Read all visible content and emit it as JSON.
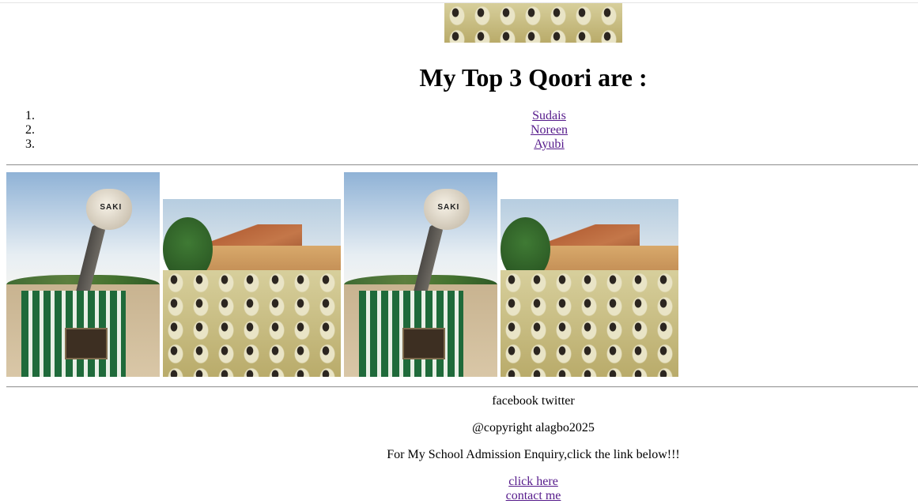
{
  "header": {
    "title": "My Top 3 Qoori are :"
  },
  "qoori_list": [
    {
      "number": "1.",
      "name": "Sudais"
    },
    {
      "number": "2.",
      "name": "Noreen"
    },
    {
      "number": "3.",
      "name": "Ayubi"
    }
  ],
  "footer": {
    "social": "facebook twitter",
    "copyright": "@copyright alagbo2025",
    "admission_text": "For My School Admission Enquiry,click the link below!!!",
    "click_here_link": "click here",
    "contact_link": "contact me"
  },
  "colors": {
    "visited_link": "#551a8b",
    "text": "#000000",
    "background": "#ffffff"
  }
}
